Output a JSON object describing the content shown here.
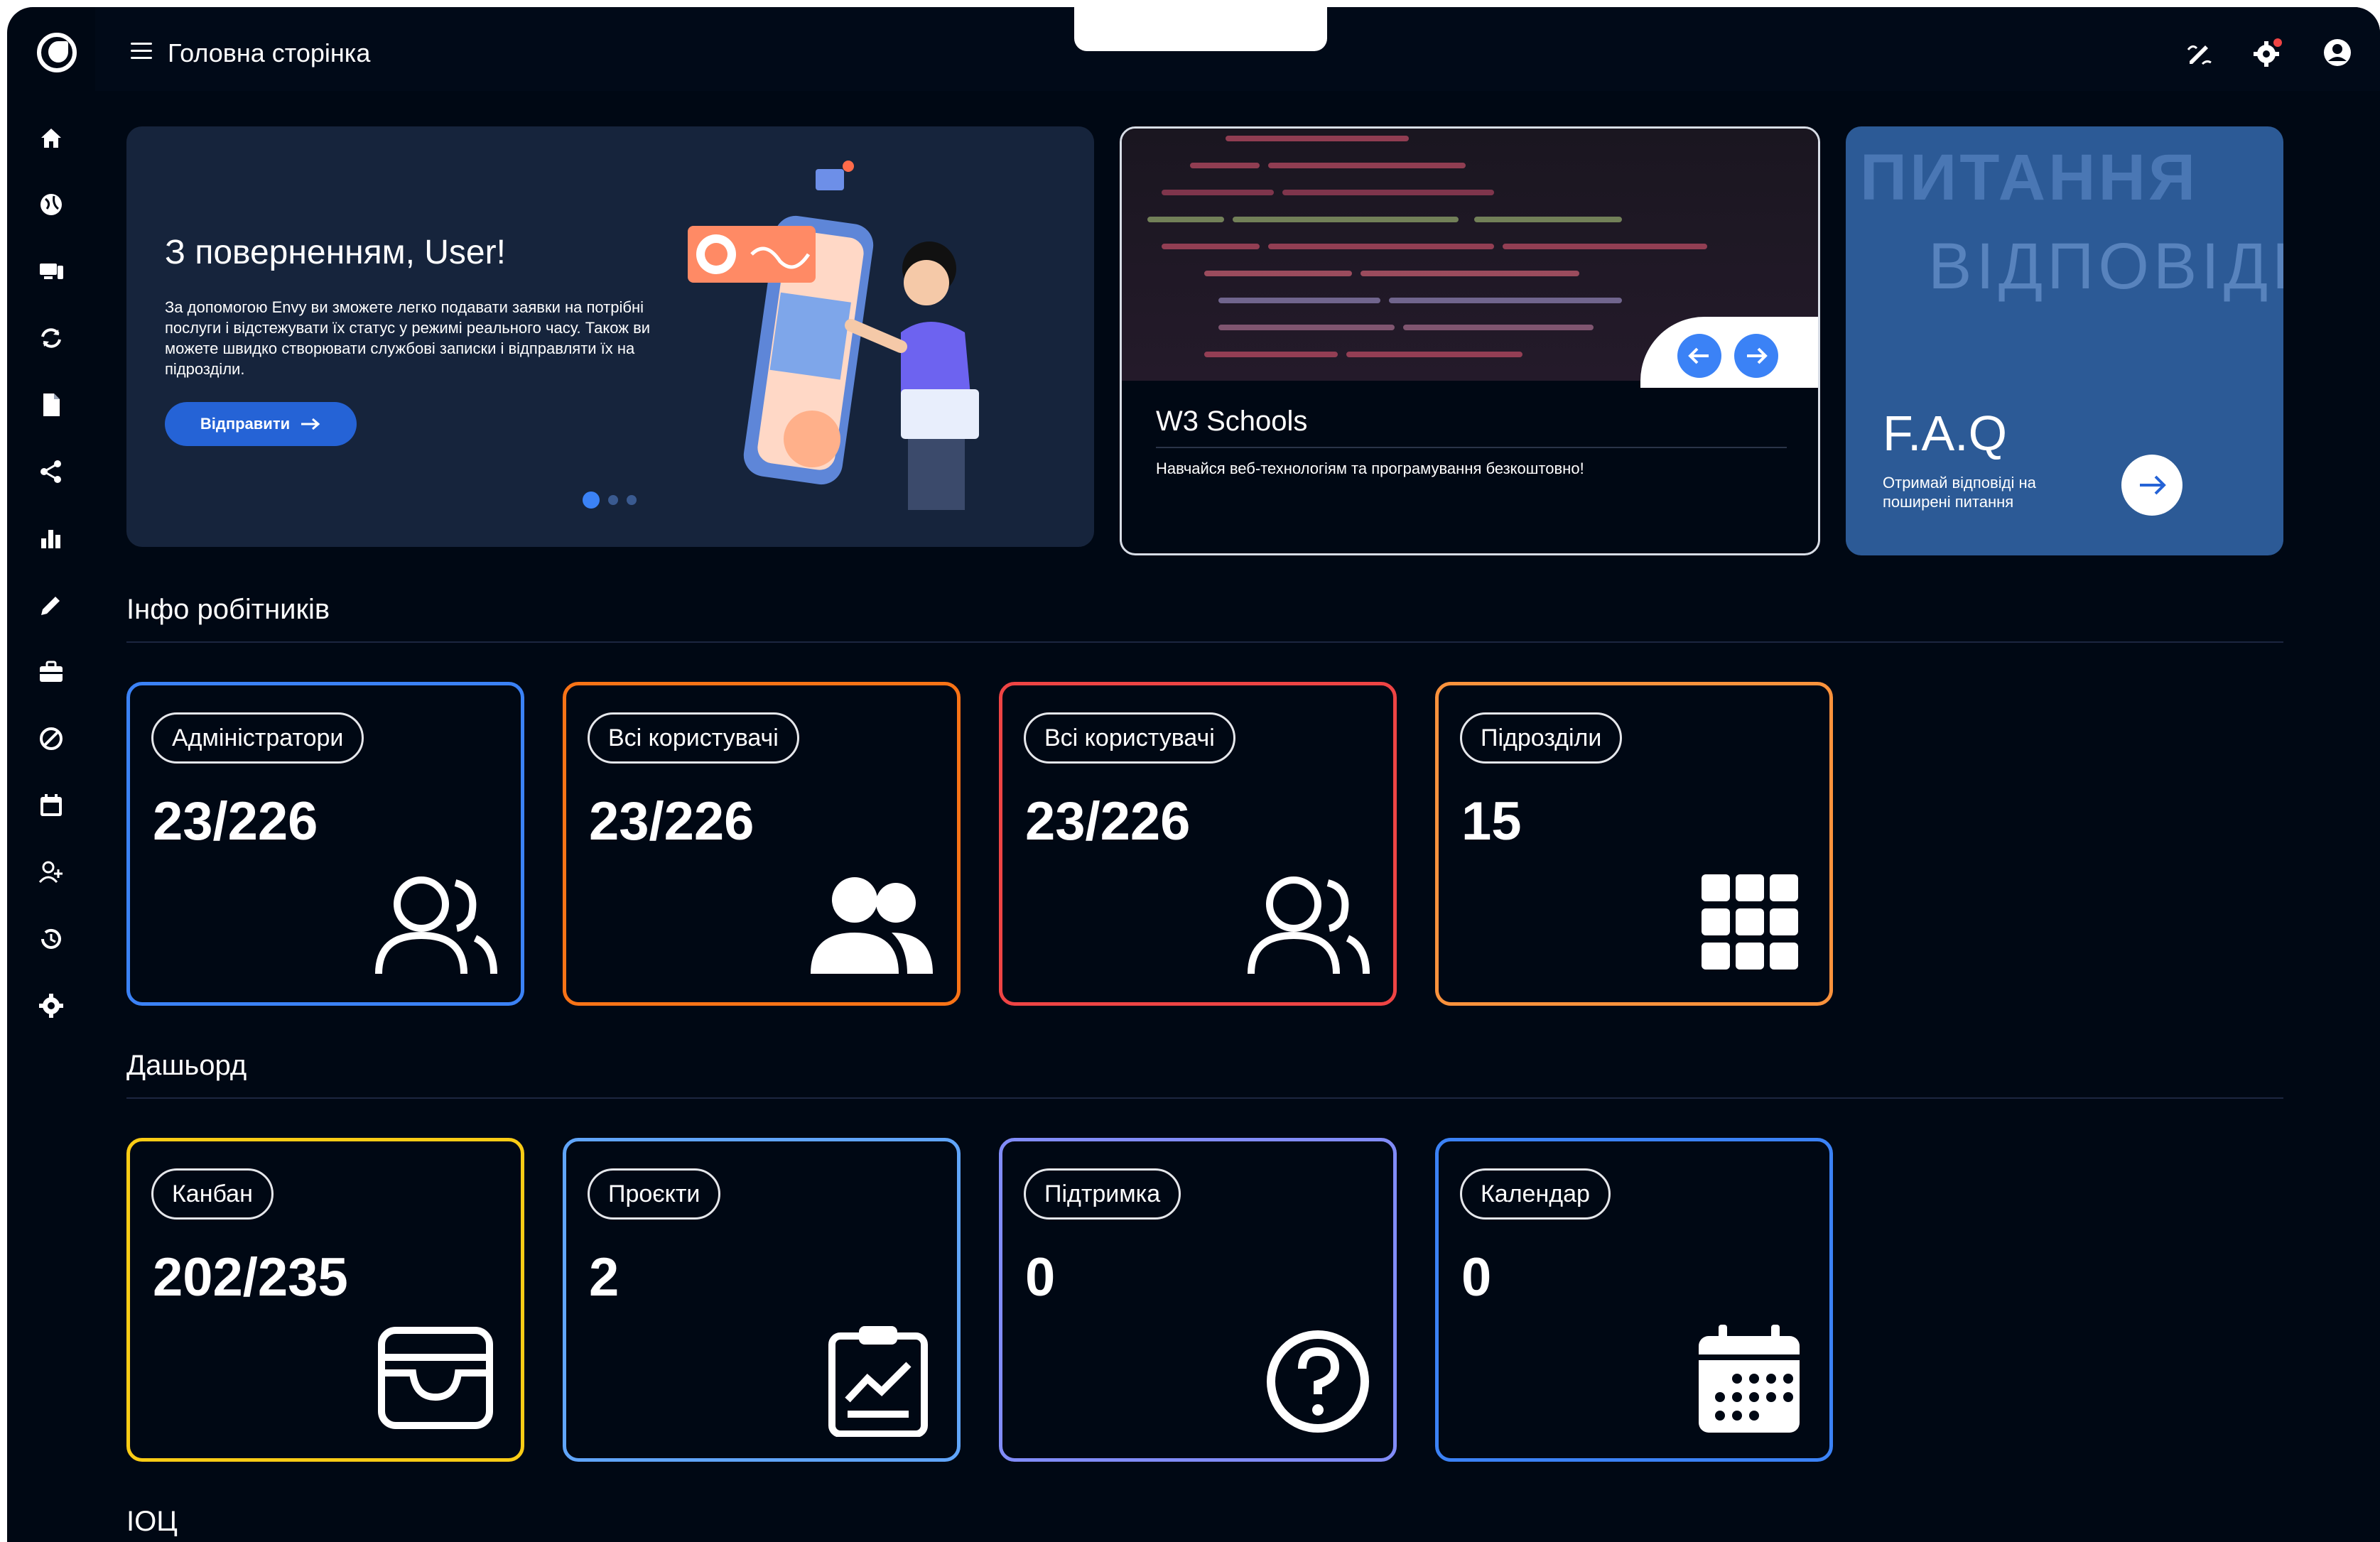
{
  "header": {
    "title": "Головна сторінка",
    "icons": [
      "menu-icon",
      "edit-note-icon",
      "notification-gear-icon",
      "account-icon"
    ]
  },
  "sidebar": {
    "icons": [
      "home-icon",
      "globe-icon",
      "devices-icon",
      "sync-icon",
      "document-icon",
      "share-icon",
      "bar-chart-icon",
      "pencil-icon",
      "briefcase-icon",
      "block-icon",
      "calendar-icon",
      "add-user-icon",
      "history-icon",
      "settings-icon"
    ]
  },
  "welcome": {
    "title": "З поверненням, User!",
    "text": "За допомогою Envy ви зможете легко подавати заявки на потрібні послуги і відстежувати їх статус у режимі реального часу. Також ви можете швидко створювати службові записки і відправляти їх на підрозділи.",
    "button": "Відправити"
  },
  "w3schools": {
    "title": "W3 Schools",
    "subtitle": "Навчайся веб-технологіям та програмування безкоштовно!"
  },
  "faq": {
    "bg_word_1": "ПИТАННЯ",
    "bg_word_2": "ВІДПОВІДЬ",
    "title": "F.A.Q",
    "text": "Отримай відповіді на поширені питання"
  },
  "workers": {
    "title": "Інфо робітників",
    "cards": [
      {
        "label": "Адміністратори",
        "value": "23/226",
        "icon": "users-outline-icon",
        "border": "#3b82f6"
      },
      {
        "label": "Всі користувачі",
        "value": "23/226",
        "icon": "users-solid-icon",
        "border": "#f97316"
      },
      {
        "label": "Всі користувачі",
        "value": "23/226",
        "icon": "users-outline-icon",
        "border": "#ef4444"
      },
      {
        "label": "Підрозділи",
        "value": "15",
        "icon": "grid-icon",
        "border": "#fb923c"
      }
    ]
  },
  "dashboard": {
    "title": "Дашьорд",
    "cards": [
      {
        "label": "Канбан",
        "value": "202/235",
        "icon": "inbox-tray-icon",
        "border": "#facc15"
      },
      {
        "label": "Проєкти",
        "value": "2",
        "icon": "clipboard-chart-icon",
        "border": "#60a5fa"
      },
      {
        "label": "Підтримка",
        "value": "0",
        "icon": "help-circle-icon",
        "border": "#818cf8"
      },
      {
        "label": "Календар",
        "value": "0",
        "icon": "calendar-icon",
        "border": "#3b82f6"
      }
    ]
  },
  "ioc": {
    "title": "ІОЦ"
  }
}
